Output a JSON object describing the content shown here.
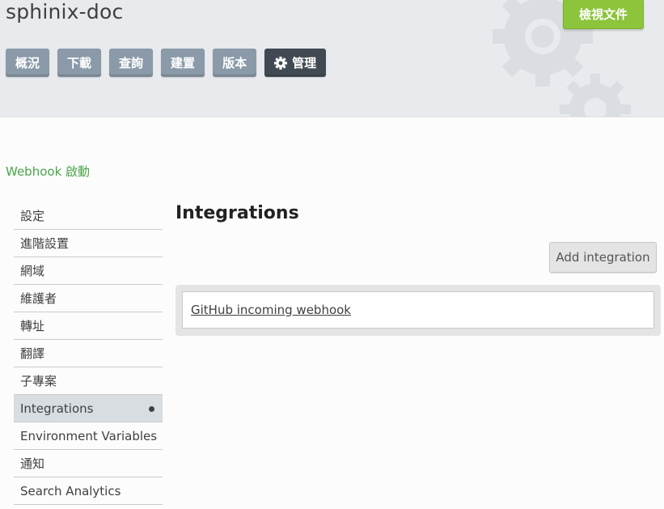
{
  "header": {
    "project_title": "sphinix-doc",
    "view_docs_label": "檢視文件",
    "tabs": [
      {
        "label": "概況"
      },
      {
        "label": "下載"
      },
      {
        "label": "查詢"
      },
      {
        "label": "建置"
      },
      {
        "label": "版本"
      },
      {
        "label": "管理",
        "icon": "gear-icon"
      }
    ]
  },
  "breadcrumb": {
    "link_label": "Webhook 啟動"
  },
  "sidebar": {
    "items": [
      {
        "label": "設定"
      },
      {
        "label": "進階設置"
      },
      {
        "label": "網域"
      },
      {
        "label": "維護者"
      },
      {
        "label": "轉址"
      },
      {
        "label": "翻譯"
      },
      {
        "label": "子專案"
      },
      {
        "label": "Integrations",
        "active": true
      },
      {
        "label": "Environment Variables"
      },
      {
        "label": "通知"
      },
      {
        "label": "Search Analytics"
      }
    ]
  },
  "main": {
    "title": "Integrations",
    "add_button_label": "Add integration",
    "integrations": [
      {
        "label": "GitHub incoming webhook"
      }
    ]
  },
  "colors": {
    "accent_green": "#8cc43c",
    "link_green": "#4aa44a",
    "tab_gray": "#8a9aa8",
    "tab_active": "#414a52"
  }
}
